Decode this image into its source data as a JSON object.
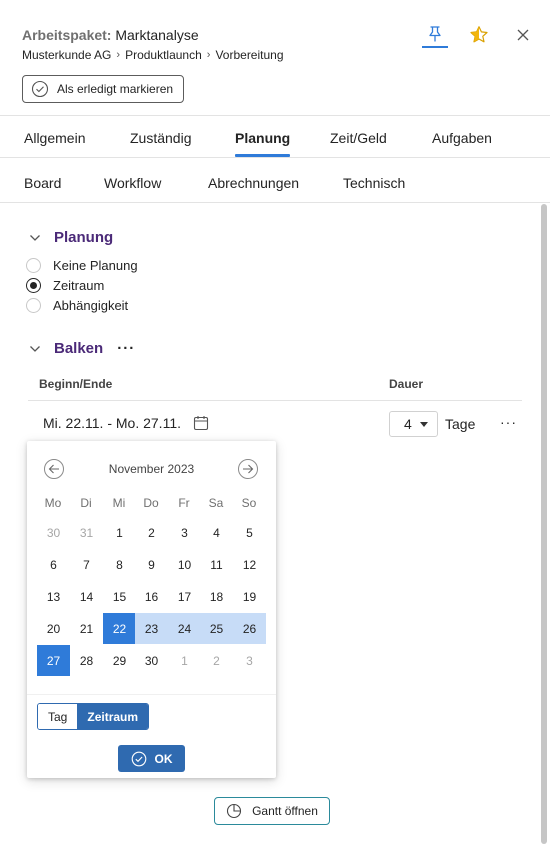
{
  "header": {
    "title_key": "Arbeitspaket:",
    "title_value": "Marktanalyse",
    "breadcrumb": [
      "Musterkunde AG",
      "Produktlaunch",
      "Vorbereitung"
    ],
    "mark_done_label": "Als erledigt markieren",
    "icons": [
      "pin-icon",
      "star-icon",
      "close-icon"
    ]
  },
  "tabs_primary": [
    {
      "label": "Allgemein"
    },
    {
      "label": "Zuständig"
    },
    {
      "label": "Planung",
      "active": true
    },
    {
      "label": "Zeit/Geld"
    },
    {
      "label": "Aufgaben"
    }
  ],
  "tabs_secondary": [
    {
      "label": "Board"
    },
    {
      "label": "Workflow"
    },
    {
      "label": "Abrechnungen"
    },
    {
      "label": "Technisch"
    }
  ],
  "planung": {
    "title": "Planung",
    "options": [
      {
        "label": "Keine Planung",
        "selected": false
      },
      {
        "label": "Zeitraum",
        "selected": true
      },
      {
        "label": "Abhängigkeit",
        "selected": false
      }
    ]
  },
  "balken": {
    "title": "Balken",
    "more": "···",
    "col_begin_end": "Beginn/Ende",
    "col_duration": "Dauer",
    "date_range": "Mi. 22.11. - Mo. 27.11.",
    "duration_value": "4",
    "duration_unit": "Tage",
    "row_more": "···"
  },
  "calendar": {
    "month_label": "November 2023",
    "weekdays": [
      "Mo",
      "Di",
      "Mi",
      "Do",
      "Fr",
      "Sa",
      "So"
    ],
    "weeks": [
      [
        {
          "d": "30",
          "m": true
        },
        {
          "d": "31",
          "m": true
        },
        {
          "d": "1"
        },
        {
          "d": "2"
        },
        {
          "d": "3"
        },
        {
          "d": "4"
        },
        {
          "d": "5"
        }
      ],
      [
        {
          "d": "6"
        },
        {
          "d": "7"
        },
        {
          "d": "8"
        },
        {
          "d": "9"
        },
        {
          "d": "10"
        },
        {
          "d": "11"
        },
        {
          "d": "12"
        }
      ],
      [
        {
          "d": "13"
        },
        {
          "d": "14"
        },
        {
          "d": "15"
        },
        {
          "d": "16"
        },
        {
          "d": "17"
        },
        {
          "d": "18"
        },
        {
          "d": "19"
        }
      ],
      [
        {
          "d": "20"
        },
        {
          "d": "21"
        },
        {
          "d": "22",
          "s": true
        },
        {
          "d": "23",
          "r": true
        },
        {
          "d": "24",
          "r": true
        },
        {
          "d": "25",
          "r": true
        },
        {
          "d": "26",
          "r": true
        }
      ],
      [
        {
          "d": "27",
          "s": true
        },
        {
          "d": "28"
        },
        {
          "d": "29"
        },
        {
          "d": "30"
        },
        {
          "d": "1",
          "m": true
        },
        {
          "d": "2",
          "m": true
        },
        {
          "d": "3",
          "m": true
        }
      ]
    ],
    "mode_day": "Tag",
    "mode_range": "Zeitraum",
    "ok_label": "OK"
  },
  "gantt_label": "Gantt öffnen",
  "colors": {
    "accent": "#2f7bd9",
    "button_primary": "#2f6ab0",
    "section_title": "#4b2a78",
    "range_fill": "#c7dcf7",
    "gantt_border": "#2b8a9b",
    "star": "#f2b50c"
  }
}
